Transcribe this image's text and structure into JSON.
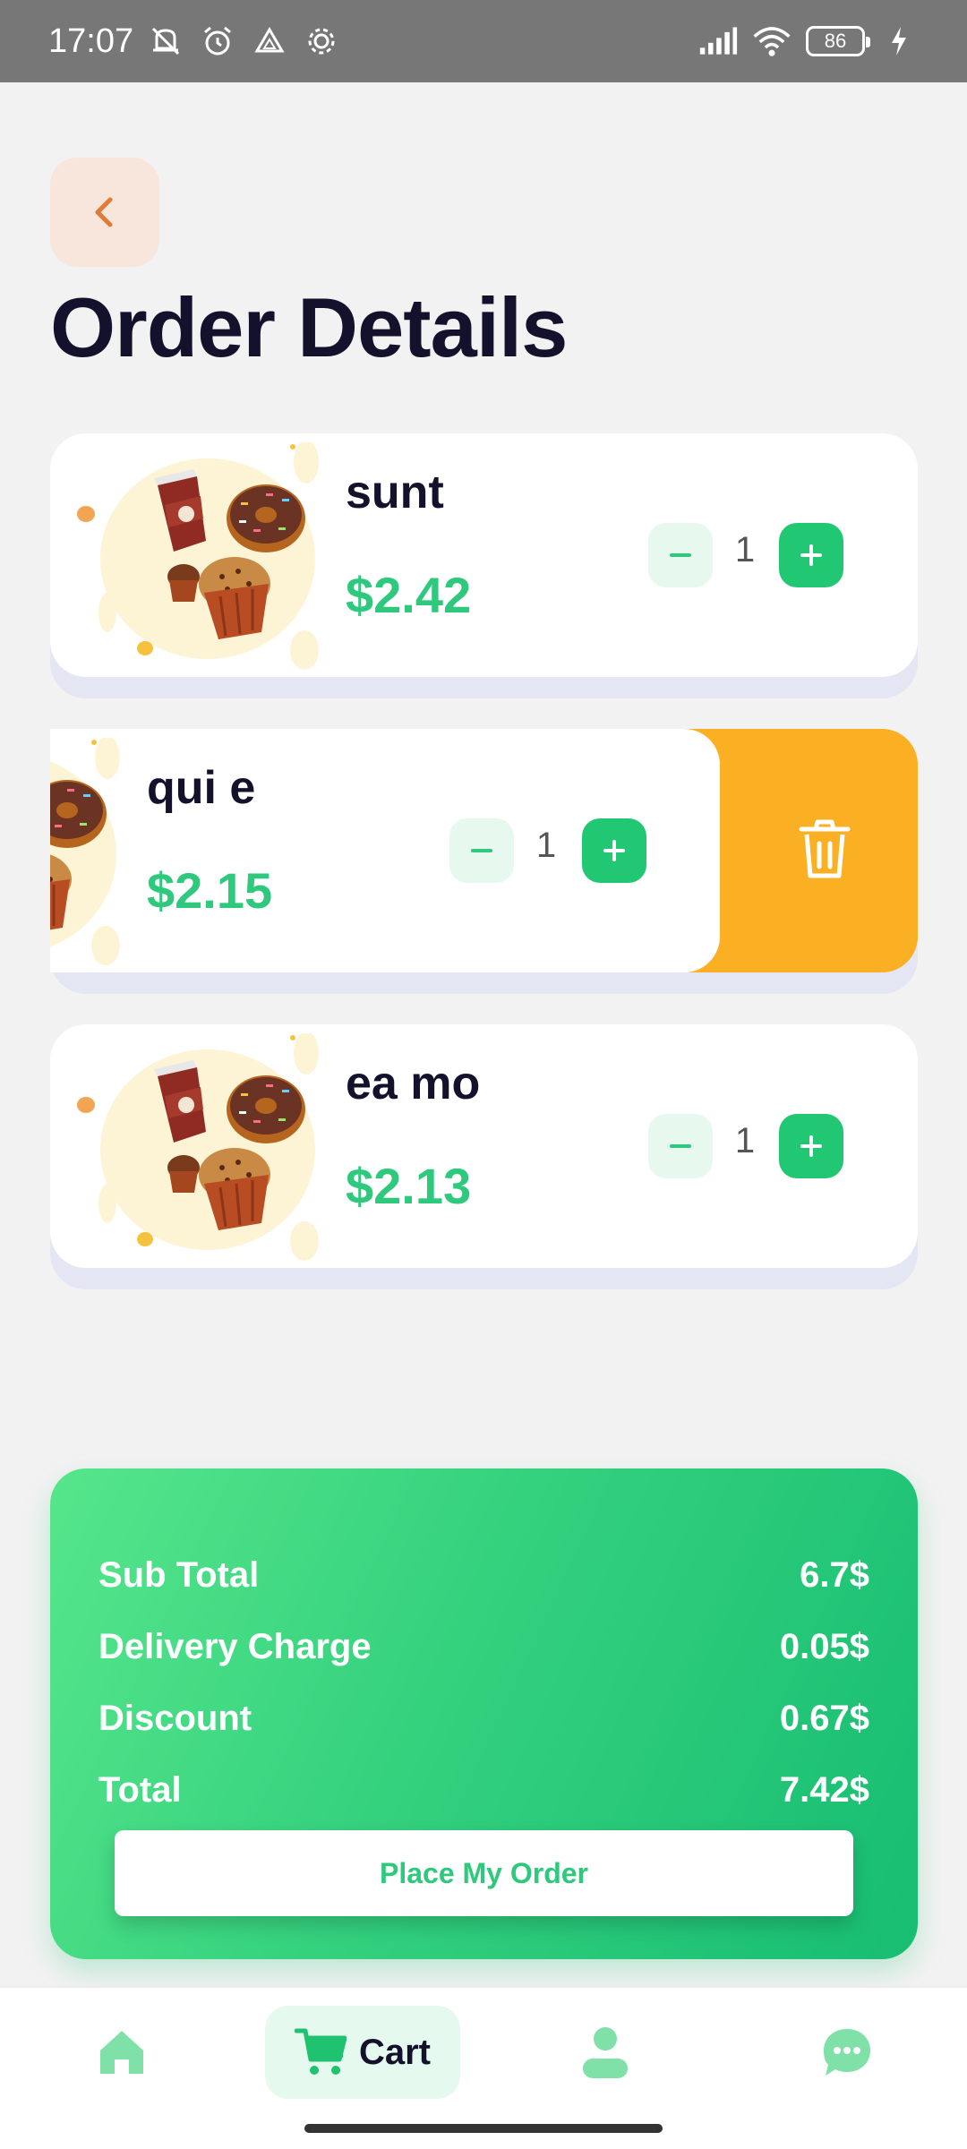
{
  "status_bar": {
    "time": "17:07",
    "battery": "86"
  },
  "header": {
    "title": "Order Details"
  },
  "items": [
    {
      "name": "sunt",
      "price": "$2.42",
      "quantity": "1"
    },
    {
      "name": "qui e",
      "price": "$2.15",
      "quantity": "1"
    },
    {
      "name": "ea mo",
      "price": "$2.13",
      "quantity": "1"
    }
  ],
  "summary": {
    "rows": [
      {
        "label": "Sub Total",
        "value": "6.7$"
      },
      {
        "label": "Delivery Charge",
        "value": "0.05$"
      },
      {
        "label": "Discount",
        "value": "0.67$"
      },
      {
        "label": "Total",
        "value": "7.42$"
      }
    ],
    "place_order_label": "Place My Order"
  },
  "bottom_nav": {
    "items": [
      {
        "icon": "home-icon"
      },
      {
        "icon": "cart-icon",
        "label": "Cart"
      },
      {
        "icon": "user-icon"
      },
      {
        "icon": "chat-icon"
      }
    ]
  },
  "colors": {
    "accent_green": "#2ec97c",
    "delete_orange": "#fbaf22",
    "back_button_bg": "#f8e6dc",
    "back_arrow": "#e07b3a"
  }
}
